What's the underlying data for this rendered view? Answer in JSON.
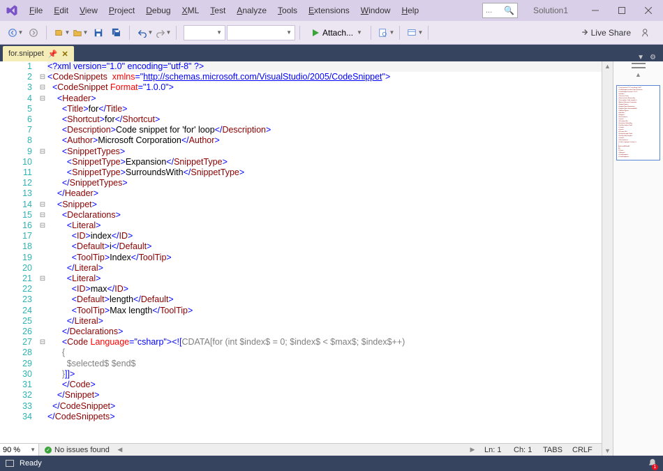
{
  "app_name": "Visual Studio",
  "solution_name": "Solution1",
  "menu": [
    "File",
    "Edit",
    "View",
    "Project",
    "Debug",
    "XML",
    "Test",
    "Analyze",
    "Tools",
    "Extensions",
    "Window",
    "Help"
  ],
  "menu_accel": [
    "F",
    "E",
    "V",
    "P",
    "D",
    "X",
    "T",
    "A",
    "T",
    "E",
    "W",
    "H"
  ],
  "search_placeholder": "...",
  "toolbar": {
    "attach_label": "Attach...",
    "live_share": "Live Share"
  },
  "tab": {
    "name": "for.snippet"
  },
  "zoom": "90 %",
  "issues_text": "No issues found",
  "status": {
    "ln_label": "Ln:",
    "ln": "1",
    "ch_label": "Ch:",
    "ch": "1",
    "tabs": "TABS",
    "crlf": "CRLF"
  },
  "statusbar_text": "Ready",
  "notification_count": "1",
  "code_lines": [
    {
      "n": 1,
      "fold": "",
      "html": "<span class='punct'>&lt;?</span><span class='xml-decl'>xml version</span><span class='punct'>=</span><span class='val'>\"1.0\"</span> <span class='xml-decl'>encoding</span><span class='punct'>=</span><span class='val'>\"utf-8\"</span> <span class='punct'>?&gt;</span>"
    },
    {
      "n": 2,
      "fold": "⊟",
      "html": "<span class='punct'>&lt;</span><span class='tag'>CodeSnippets</span>  <span class='attr'>xmlns</span><span class='punct'>=\"</span><span class='lnk'>http://schemas.microsoft.com/VisualStudio/2005/CodeSnippet</span><span class='punct'>\"&gt;</span>"
    },
    {
      "n": 3,
      "fold": "⊟",
      "html": "  <span class='punct'>&lt;</span><span class='tag'>CodeSnippet</span> <span class='attr'>Format</span><span class='punct'>=</span><span class='val'>\"1.0.0\"</span><span class='punct'>&gt;</span>"
    },
    {
      "n": 4,
      "fold": "⊟",
      "html": "    <span class='punct'>&lt;</span><span class='tag'>Header</span><span class='punct'>&gt;</span>"
    },
    {
      "n": 5,
      "fold": "",
      "html": "      <span class='punct'>&lt;</span><span class='tag'>Title</span><span class='punct'>&gt;</span><span class='txt'>for</span><span class='punct'>&lt;/</span><span class='tag'>Title</span><span class='punct'>&gt;</span>"
    },
    {
      "n": 6,
      "fold": "",
      "html": "      <span class='punct'>&lt;</span><span class='tag'>Shortcut</span><span class='punct'>&gt;</span><span class='txt'>for</span><span class='punct'>&lt;/</span><span class='tag'>Shortcut</span><span class='punct'>&gt;</span>"
    },
    {
      "n": 7,
      "fold": "",
      "html": "      <span class='punct'>&lt;</span><span class='tag'>Description</span><span class='punct'>&gt;</span><span class='txt'>Code snippet for 'for' loop</span><span class='punct'>&lt;/</span><span class='tag'>Description</span><span class='punct'>&gt;</span>"
    },
    {
      "n": 8,
      "fold": "",
      "html": "      <span class='punct'>&lt;</span><span class='tag'>Author</span><span class='punct'>&gt;</span><span class='txt'>Microsoft Corporation</span><span class='punct'>&lt;/</span><span class='tag'>Author</span><span class='punct'>&gt;</span>"
    },
    {
      "n": 9,
      "fold": "⊟",
      "html": "      <span class='punct'>&lt;</span><span class='tag'>SnippetTypes</span><span class='punct'>&gt;</span>"
    },
    {
      "n": 10,
      "fold": "",
      "html": "        <span class='punct'>&lt;</span><span class='tag'>SnippetType</span><span class='punct'>&gt;</span><span class='txt'>Expansion</span><span class='punct'>&lt;/</span><span class='tag'>SnippetType</span><span class='punct'>&gt;</span>"
    },
    {
      "n": 11,
      "fold": "",
      "html": "        <span class='punct'>&lt;</span><span class='tag'>SnippetType</span><span class='punct'>&gt;</span><span class='txt'>SurroundsWith</span><span class='punct'>&lt;/</span><span class='tag'>SnippetType</span><span class='punct'>&gt;</span>"
    },
    {
      "n": 12,
      "fold": "",
      "html": "      <span class='punct'>&lt;/</span><span class='tag'>SnippetTypes</span><span class='punct'>&gt;</span>"
    },
    {
      "n": 13,
      "fold": "",
      "html": "    <span class='punct'>&lt;/</span><span class='tag'>Header</span><span class='punct'>&gt;</span>"
    },
    {
      "n": 14,
      "fold": "⊟",
      "html": "    <span class='punct'>&lt;</span><span class='tag'>Snippet</span><span class='punct'>&gt;</span>"
    },
    {
      "n": 15,
      "fold": "⊟",
      "html": "      <span class='punct'>&lt;</span><span class='tag'>Declarations</span><span class='punct'>&gt;</span>"
    },
    {
      "n": 16,
      "fold": "⊟",
      "html": "        <span class='punct'>&lt;</span><span class='tag'>Literal</span><span class='punct'>&gt;</span>"
    },
    {
      "n": 17,
      "fold": "",
      "html": "          <span class='punct'>&lt;</span><span class='tag'>ID</span><span class='punct'>&gt;</span><span class='txt'>index</span><span class='punct'>&lt;/</span><span class='tag'>ID</span><span class='punct'>&gt;</span>"
    },
    {
      "n": 18,
      "fold": "",
      "html": "          <span class='punct'>&lt;</span><span class='tag'>Default</span><span class='punct'>&gt;</span><span class='txt'>i</span><span class='punct'>&lt;/</span><span class='tag'>Default</span><span class='punct'>&gt;</span>"
    },
    {
      "n": 19,
      "fold": "",
      "html": "          <span class='punct'>&lt;</span><span class='tag'>ToolTip</span><span class='punct'>&gt;</span><span class='txt'>Index</span><span class='punct'>&lt;/</span><span class='tag'>ToolTip</span><span class='punct'>&gt;</span>"
    },
    {
      "n": 20,
      "fold": "",
      "html": "        <span class='punct'>&lt;/</span><span class='tag'>Literal</span><span class='punct'>&gt;</span>"
    },
    {
      "n": 21,
      "fold": "⊟",
      "html": "        <span class='punct'>&lt;</span><span class='tag'>Literal</span><span class='punct'>&gt;</span>"
    },
    {
      "n": 22,
      "fold": "",
      "html": "          <span class='punct'>&lt;</span><span class='tag'>ID</span><span class='punct'>&gt;</span><span class='txt'>max</span><span class='punct'>&lt;/</span><span class='tag'>ID</span><span class='punct'>&gt;</span>"
    },
    {
      "n": 23,
      "fold": "",
      "html": "          <span class='punct'>&lt;</span><span class='tag'>Default</span><span class='punct'>&gt;</span><span class='txt'>length</span><span class='punct'>&lt;/</span><span class='tag'>Default</span><span class='punct'>&gt;</span>"
    },
    {
      "n": 24,
      "fold": "",
      "html": "          <span class='punct'>&lt;</span><span class='tag'>ToolTip</span><span class='punct'>&gt;</span><span class='txt'>Max length</span><span class='punct'>&lt;/</span><span class='tag'>ToolTip</span><span class='punct'>&gt;</span>"
    },
    {
      "n": 25,
      "fold": "",
      "html": "        <span class='punct'>&lt;/</span><span class='tag'>Literal</span><span class='punct'>&gt;</span>"
    },
    {
      "n": 26,
      "fold": "",
      "html": "      <span class='punct'>&lt;/</span><span class='tag'>Declarations</span><span class='punct'>&gt;</span>"
    },
    {
      "n": 27,
      "fold": "⊟",
      "html": "      <span class='punct'>&lt;</span><span class='tag'>Code</span> <span class='attr'>Language</span><span class='punct'>=</span><span class='val'>\"csharp\"</span><span class='punct'>&gt;</span><span class='brk'>&lt;![</span><span class='cdata'>CDATA[for (int $index$ = 0; $index$ &lt; $max$; $index$++)</span>"
    },
    {
      "n": 28,
      "fold": "",
      "html": "      <span class='cdata'>{</span>"
    },
    {
      "n": 29,
      "fold": "",
      "html": "        <span class='cdata'>$selected$ $end$</span>"
    },
    {
      "n": 30,
      "fold": "",
      "html": "      <span class='cdata'>}</span><span class='brk'>]]&gt;</span>"
    },
    {
      "n": 31,
      "fold": "",
      "html": "      <span class='punct'>&lt;/</span><span class='tag'>Code</span><span class='punct'>&gt;</span>"
    },
    {
      "n": 32,
      "fold": "",
      "html": "    <span class='punct'>&lt;/</span><span class='tag'>Snippet</span><span class='punct'>&gt;</span>"
    },
    {
      "n": 33,
      "fold": "",
      "html": "  <span class='punct'>&lt;/</span><span class='tag'>CodeSnippet</span><span class='punct'>&gt;</span>"
    },
    {
      "n": 34,
      "fold": "",
      "html": "<span class='punct'>&lt;/</span><span class='tag'>CodeSnippets</span><span class='punct'>&gt;</span>"
    }
  ]
}
